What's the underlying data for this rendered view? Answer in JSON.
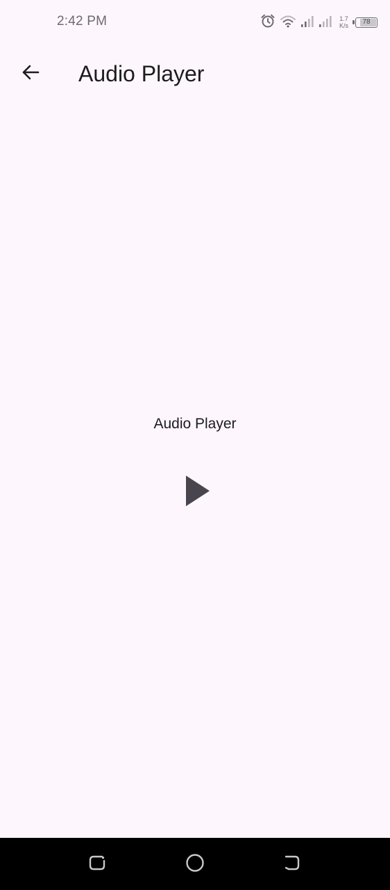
{
  "status_bar": {
    "time": "2:42 PM",
    "net_speed_value": "1.7",
    "net_speed_unit": "K/s",
    "battery_level": "78",
    "battery_fraction": 0.78
  },
  "app_bar": {
    "title": "Audio Player"
  },
  "main": {
    "player_label": "Audio Player",
    "play_state": "paused"
  },
  "colors": {
    "background": "#fdf7fd",
    "text": "#1d1b20",
    "play_icon": "#49454f",
    "nav_bar": "#000000",
    "nav_icon": "#c8c8c8"
  },
  "icons": {
    "back": "arrow-left",
    "play": "play-triangle",
    "alarm": "alarm-clock",
    "wifi": "wifi",
    "signal_1": "signal-bars",
    "signal_2": "signal-bars",
    "nav_recents": "recents",
    "nav_home": "home-circle",
    "nav_back": "back-return"
  }
}
